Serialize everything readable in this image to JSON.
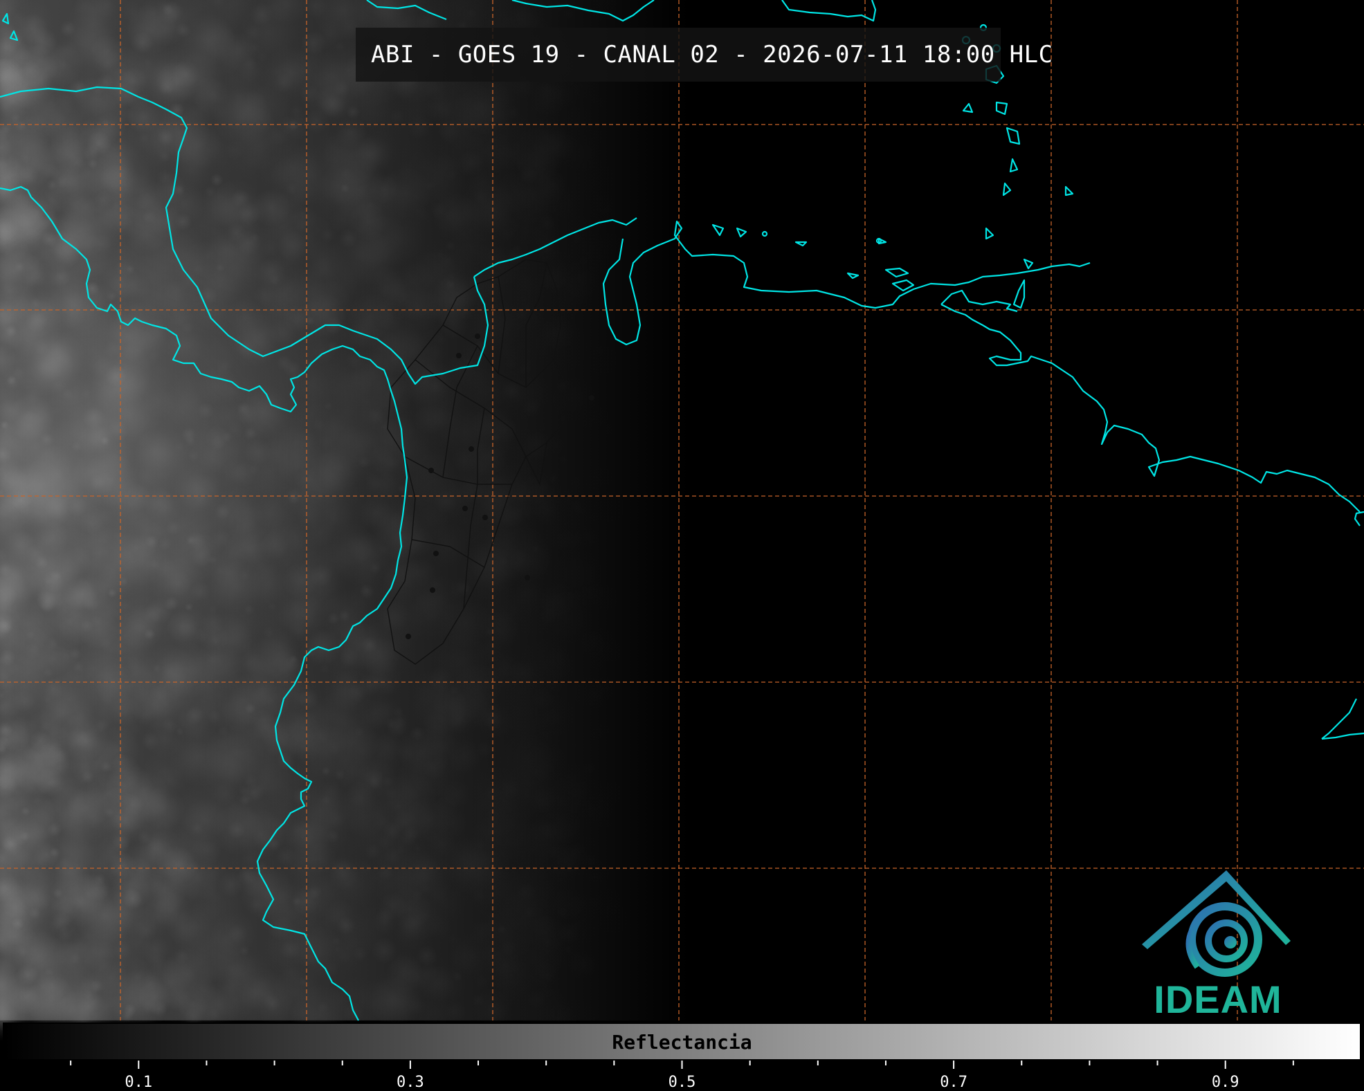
{
  "title": "ABI - GOES 19 - CANAL 02 - 2026-07-11 18:00 HLC",
  "colorbar": {
    "label": "Reflectancia",
    "min": 0.0,
    "max": 1.0,
    "major_ticks": [
      "0.1",
      "0.3",
      "0.5",
      "0.7",
      "0.9"
    ],
    "major_values": [
      0.1,
      0.3,
      0.5,
      0.7,
      0.9
    ],
    "minor_values": [
      0.05,
      0.15,
      0.2,
      0.25,
      0.35,
      0.4,
      0.45,
      0.55,
      0.6,
      0.65,
      0.75,
      0.8,
      0.85,
      0.95
    ]
  },
  "logo": {
    "text": "IDEAM"
  },
  "colors": {
    "coastline": "#00e5e5",
    "gridline": "#c8642a",
    "admin_border": "#111111",
    "logo_green": "#1fb59a",
    "logo_blue": "#2d6fb0"
  }
}
